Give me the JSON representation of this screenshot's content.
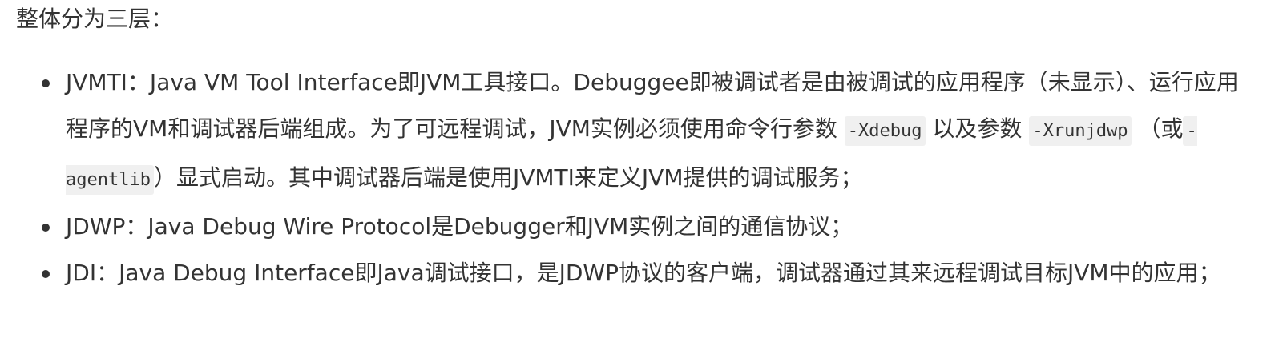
{
  "intro": "整体分为三层：",
  "items": [
    {
      "seg1": "JVMTI：Java VM Tool Interface即JVM工具接口。Debuggee即被调试者是由被调试的应用程序（未显示）、运行应用程序的VM和调试器后端组成。为了可远程调试，JVM实例必须使用命令行参数",
      "code1": "-Xdebug",
      "seg2": "以及参数",
      "code2": "-Xrunjdwp",
      "seg3": "（或",
      "code3": "-agentlib",
      "seg4": "）显式启动。其中调试器后端是使用JVMTI来定义JVM提供的调试服务；"
    },
    {
      "text": "JDWP：Java Debug Wire Protocol是Debugger和JVM实例之间的通信协议；"
    },
    {
      "text": "JDI：Java Debug Interface即Java调试接口，是JDWP协议的客户端，调试器通过其来远程调试目标JVM中的应用；"
    }
  ]
}
